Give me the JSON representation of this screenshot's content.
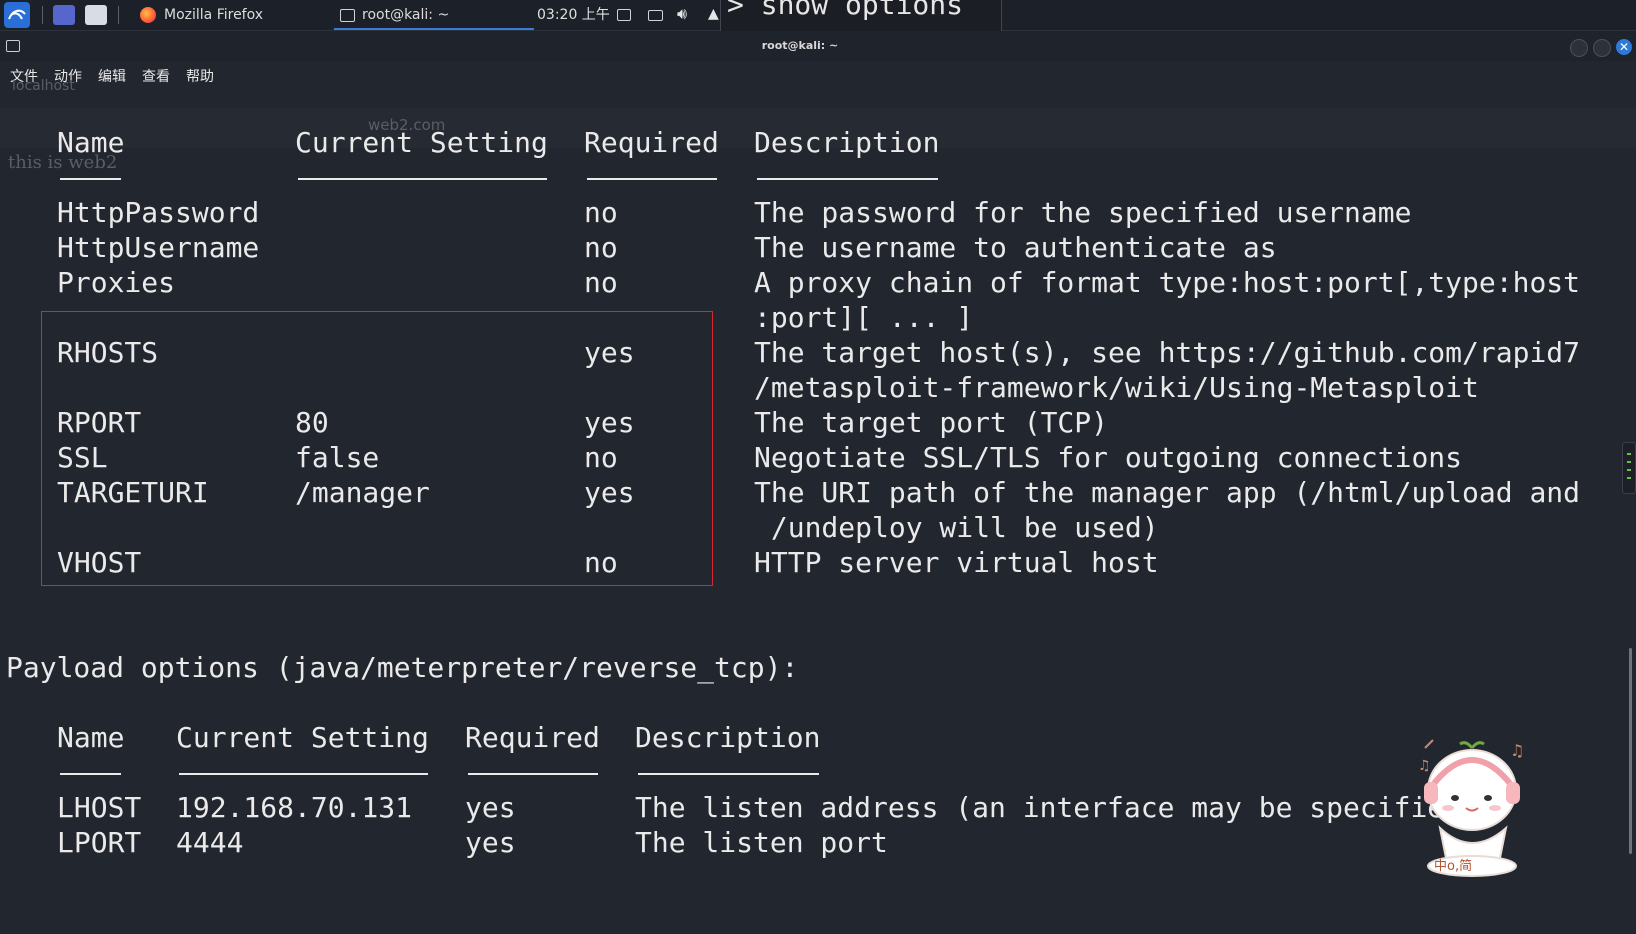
{
  "taskbar": {
    "firefox_task": "Mozilla Firefox",
    "terminal_task": "root@kali: ~",
    "clock": "03:20 上午",
    "overlay_command": "> show options"
  },
  "window": {
    "title": "root@kali: ~"
  },
  "menu": [
    "文件",
    "动作",
    "编辑",
    "查看",
    "帮助"
  ],
  "ghost": {
    "page_text": "this is web2",
    "url": "web2.com",
    "tab": "localhost"
  },
  "module_options": {
    "headers": [
      "Name",
      "Current Setting",
      "Required",
      "Description"
    ],
    "rows": [
      {
        "name": "HttpPassword",
        "setting": "",
        "required": "no",
        "desc": [
          "The password for the specified username"
        ]
      },
      {
        "name": "HttpUsername",
        "setting": "",
        "required": "no",
        "desc": [
          "The username to authenticate as"
        ]
      },
      {
        "name": "Proxies",
        "setting": "",
        "required": "no",
        "desc": [
          "A proxy chain of format type:host:port[,type:host",
          ":port][ ... ]"
        ]
      },
      {
        "name": "RHOSTS",
        "setting": "",
        "required": "yes",
        "desc": [
          "The target host(s), see https://github.com/rapid7",
          "/metasploit-framework/wiki/Using-Metasploit"
        ]
      },
      {
        "name": "RPORT",
        "setting": "80",
        "required": "yes",
        "desc": [
          "The target port (TCP)"
        ]
      },
      {
        "name": "SSL",
        "setting": "false",
        "required": "no",
        "desc": [
          "Negotiate SSL/TLS for outgoing connections"
        ]
      },
      {
        "name": "TARGETURI",
        "setting": "/manager",
        "required": "yes",
        "desc": [
          "The URI path of the manager app (/html/upload and",
          " /undeploy will be used)"
        ]
      },
      {
        "name": "VHOST",
        "setting": "",
        "required": "no",
        "desc": [
          "HTTP server virtual host"
        ]
      }
    ]
  },
  "payload": {
    "title": "Payload options (java/meterpreter/reverse_tcp):",
    "headers": [
      "Name",
      "Current Setting",
      "Required",
      "Description"
    ],
    "rows": [
      {
        "name": "LHOST",
        "setting": "192.168.70.131",
        "required": "yes",
        "desc": "The listen address (an interface may be specifie"
      },
      {
        "name": "LPORT",
        "setting": "4444",
        "required": "yes",
        "desc": "The listen port"
      }
    ]
  },
  "mascot": {
    "caption": "中o,简"
  },
  "colors": {
    "terminal_bg": "#22262e",
    "highlight_box": "#d8282d",
    "accent": "#2f7ad9"
  }
}
